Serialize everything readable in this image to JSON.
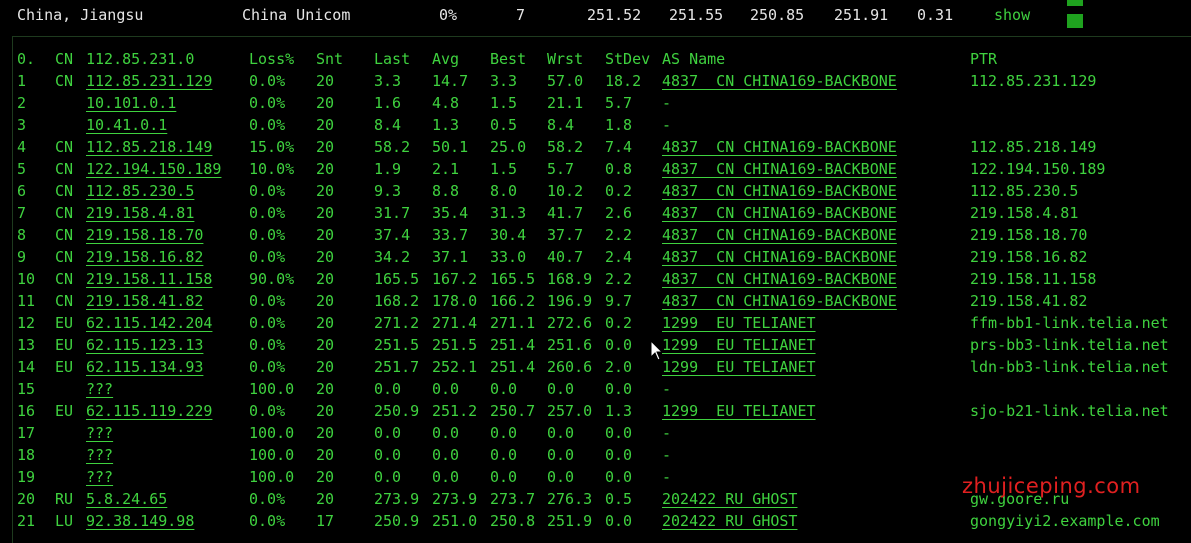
{
  "summary": {
    "location": "China, Jiangsu",
    "isp": "China Unicom",
    "loss": "0%",
    "sent": "7",
    "last": "251.52",
    "avg": "251.55",
    "best": "250.85",
    "worst": "251.91",
    "stdev": "0.31",
    "show_label": "show"
  },
  "headers": [
    "0.",
    "CN",
    "112.85.231.0",
    "Loss%",
    "Snt",
    "Last",
    "Avg",
    "Best",
    "Wrst",
    "StDev",
    "AS Name",
    "PTR"
  ],
  "rows": [
    {
      "hop": "1",
      "cc": "CN",
      "ip": "112.85.231.129",
      "loss": "0.0%",
      "snt": "20",
      "last": "3.3",
      "avg": "14.7",
      "best": "3.3",
      "wrst": "57.0",
      "stdev": "18.2",
      "as": "4837  CN CHINA169-BACKBONE",
      "ptr": "112.85.231.129"
    },
    {
      "hop": "2",
      "cc": "",
      "ip": "10.101.0.1",
      "loss": "0.0%",
      "snt": "20",
      "last": "1.6",
      "avg": "4.8",
      "best": "1.5",
      "wrst": "21.1",
      "stdev": "5.7",
      "as": "-",
      "ptr": ""
    },
    {
      "hop": "3",
      "cc": "",
      "ip": "10.41.0.1",
      "loss": "0.0%",
      "snt": "20",
      "last": "8.4",
      "avg": "1.3",
      "best": "0.5",
      "wrst": "8.4",
      "stdev": "1.8",
      "as": "-",
      "ptr": ""
    },
    {
      "hop": "4",
      "cc": "CN",
      "ip": "112.85.218.149",
      "loss": "15.0%",
      "snt": "20",
      "last": "58.2",
      "avg": "50.1",
      "best": "25.0",
      "wrst": "58.2",
      "stdev": "7.4",
      "as": "4837  CN CHINA169-BACKBONE",
      "ptr": "112.85.218.149"
    },
    {
      "hop": "5",
      "cc": "CN",
      "ip": "122.194.150.189",
      "loss": "10.0%",
      "snt": "20",
      "last": "1.9",
      "avg": "2.1",
      "best": "1.5",
      "wrst": "5.7",
      "stdev": "0.8",
      "as": "4837  CN CHINA169-BACKBONE",
      "ptr": "122.194.150.189"
    },
    {
      "hop": "6",
      "cc": "CN",
      "ip": "112.85.230.5",
      "loss": "0.0%",
      "snt": "20",
      "last": "9.3",
      "avg": "8.8",
      "best": "8.0",
      "wrst": "10.2",
      "stdev": "0.2",
      "as": "4837  CN CHINA169-BACKBONE",
      "ptr": "112.85.230.5"
    },
    {
      "hop": "7",
      "cc": "CN",
      "ip": "219.158.4.81",
      "loss": "0.0%",
      "snt": "20",
      "last": "31.7",
      "avg": "35.4",
      "best": "31.3",
      "wrst": "41.7",
      "stdev": "2.6",
      "as": "4837  CN CHINA169-BACKBONE",
      "ptr": "219.158.4.81"
    },
    {
      "hop": "8",
      "cc": "CN",
      "ip": "219.158.18.70",
      "loss": "0.0%",
      "snt": "20",
      "last": "37.4",
      "avg": "33.7",
      "best": "30.4",
      "wrst": "37.7",
      "stdev": "2.2",
      "as": "4837  CN CHINA169-BACKBONE",
      "ptr": "219.158.18.70"
    },
    {
      "hop": "9",
      "cc": "CN",
      "ip": "219.158.16.82",
      "loss": "0.0%",
      "snt": "20",
      "last": "34.2",
      "avg": "37.1",
      "best": "33.0",
      "wrst": "40.7",
      "stdev": "2.4",
      "as": "4837  CN CHINA169-BACKBONE",
      "ptr": "219.158.16.82"
    },
    {
      "hop": "10",
      "cc": "CN",
      "ip": "219.158.11.158",
      "loss": "90.0%",
      "snt": "20",
      "last": "165.5",
      "avg": "167.2",
      "best": "165.5",
      "wrst": "168.9",
      "stdev": "2.2",
      "as": "4837  CN CHINA169-BACKBONE",
      "ptr": "219.158.11.158"
    },
    {
      "hop": "11",
      "cc": "CN",
      "ip": "219.158.41.82",
      "loss": "0.0%",
      "snt": "20",
      "last": "168.2",
      "avg": "178.0",
      "best": "166.2",
      "wrst": "196.9",
      "stdev": "9.7",
      "as": "4837  CN CHINA169-BACKBONE",
      "ptr": "219.158.41.82"
    },
    {
      "hop": "12",
      "cc": "EU",
      "ip": "62.115.142.204",
      "loss": "0.0%",
      "snt": "20",
      "last": "271.2",
      "avg": "271.4",
      "best": "271.1",
      "wrst": "272.6",
      "stdev": "0.2",
      "as": "1299  EU TELIANET",
      "ptr": "ffm-bb1-link.telia.net"
    },
    {
      "hop": "13",
      "cc": "EU",
      "ip": "62.115.123.13",
      "loss": "0.0%",
      "snt": "20",
      "last": "251.5",
      "avg": "251.5",
      "best": "251.4",
      "wrst": "251.6",
      "stdev": "0.0",
      "as": "1299  EU TELIANET",
      "ptr": "prs-bb3-link.telia.net"
    },
    {
      "hop": "14",
      "cc": "EU",
      "ip": "62.115.134.93",
      "loss": "0.0%",
      "snt": "20",
      "last": "251.7",
      "avg": "252.1",
      "best": "251.4",
      "wrst": "260.6",
      "stdev": "2.0",
      "as": "1299  EU TELIANET",
      "ptr": "ldn-bb3-link.telia.net"
    },
    {
      "hop": "15",
      "cc": "",
      "ip": "???",
      "loss": "100.0",
      "snt": "20",
      "last": "0.0",
      "avg": "0.0",
      "best": "0.0",
      "wrst": "0.0",
      "stdev": "0.0",
      "as": "-",
      "ptr": ""
    },
    {
      "hop": "16",
      "cc": "EU",
      "ip": "62.115.119.229",
      "loss": "0.0%",
      "snt": "20",
      "last": "250.9",
      "avg": "251.2",
      "best": "250.7",
      "wrst": "257.0",
      "stdev": "1.3",
      "as": "1299  EU TELIANET",
      "ptr": "sjo-b21-link.telia.net"
    },
    {
      "hop": "17",
      "cc": "",
      "ip": "???",
      "loss": "100.0",
      "snt": "20",
      "last": "0.0",
      "avg": "0.0",
      "best": "0.0",
      "wrst": "0.0",
      "stdev": "0.0",
      "as": "-",
      "ptr": ""
    },
    {
      "hop": "18",
      "cc": "",
      "ip": "???",
      "loss": "100.0",
      "snt": "20",
      "last": "0.0",
      "avg": "0.0",
      "best": "0.0",
      "wrst": "0.0",
      "stdev": "0.0",
      "as": "-",
      "ptr": ""
    },
    {
      "hop": "19",
      "cc": "",
      "ip": "???",
      "loss": "100.0",
      "snt": "20",
      "last": "0.0",
      "avg": "0.0",
      "best": "0.0",
      "wrst": "0.0",
      "stdev": "0.0",
      "as": "-",
      "ptr": ""
    },
    {
      "hop": "20",
      "cc": "RU",
      "ip": "5.8.24.65",
      "loss": "0.0%",
      "snt": "20",
      "last": "273.9",
      "avg": "273.9",
      "best": "273.7",
      "wrst": "276.3",
      "stdev": "0.5",
      "as": "202422 RU GHOST",
      "ptr": "gw.goore.ru"
    },
    {
      "hop": "21",
      "cc": "LU",
      "ip": "92.38.149.98",
      "loss": "0.0%",
      "snt": "17",
      "last": "250.9",
      "avg": "251.0",
      "best": "250.8",
      "wrst": "251.9",
      "stdev": "0.0",
      "as": "202422 RU GHOST",
      "ptr": "gongyiyi2.example.com"
    }
  ],
  "watermark": "zhujiceping.com",
  "colors": {
    "text_green": "#3fd23f",
    "watermark_red": "#e02020",
    "background": "#000000"
  }
}
